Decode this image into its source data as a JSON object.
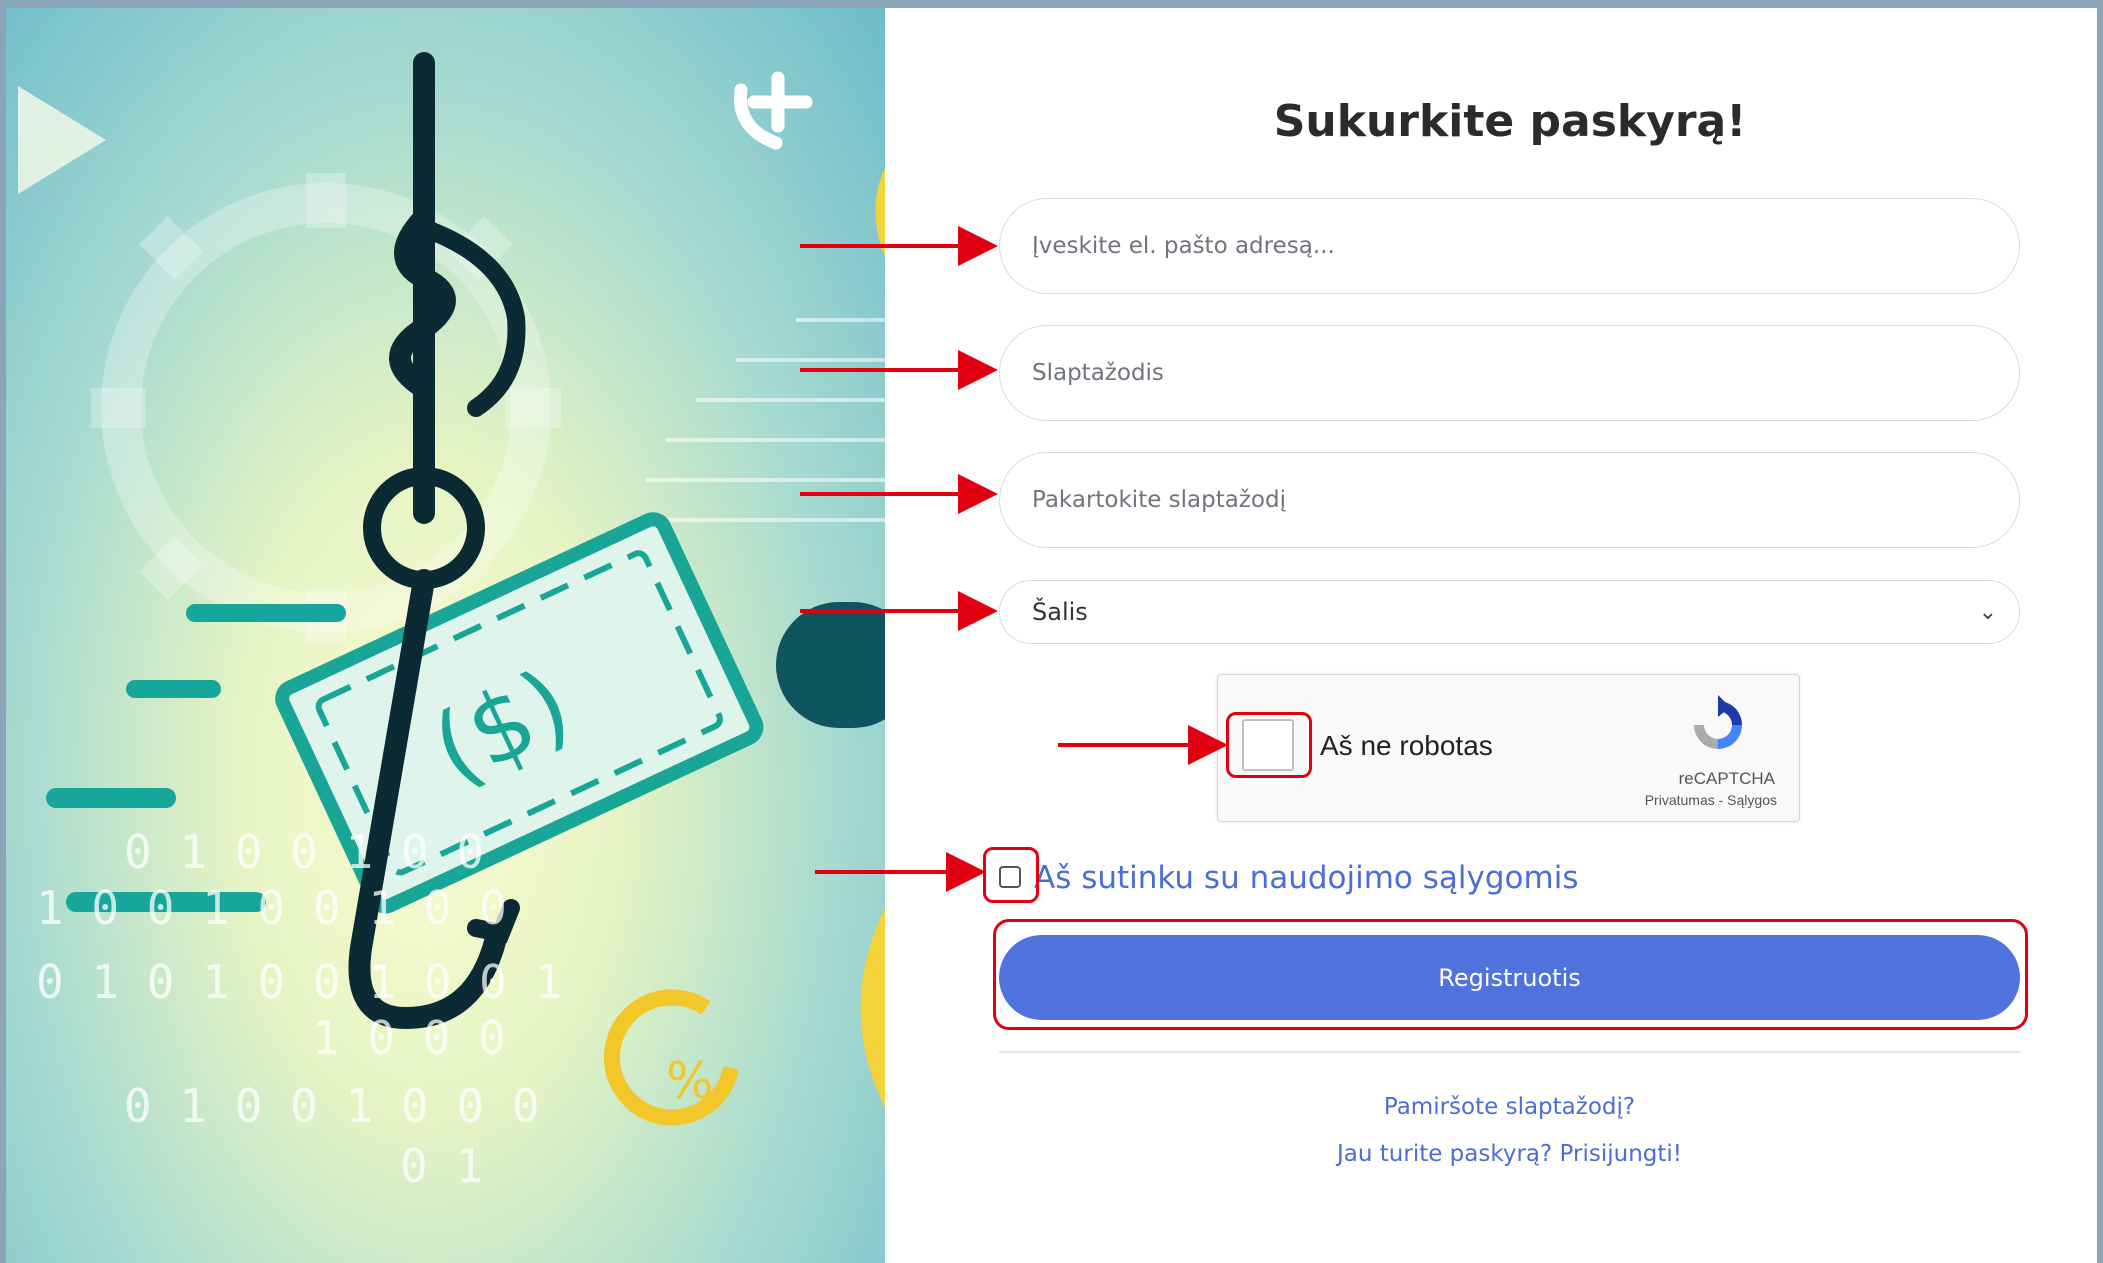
{
  "form": {
    "title": "Sukurkite paskyrą!",
    "email_placeholder": "Įveskite el. pašto adresą...",
    "password_placeholder": "Slaptažodis",
    "repeat_password_placeholder": "Pakartokite slaptažodį",
    "country_select": "Šalis",
    "terms_label": "Aš sutinku su naudojimo sąlygomis",
    "register_button": "Registruotis",
    "forgot_password_link": "Pamiršote slaptažodį?",
    "login_link": "Jau turite paskyrą? Prisijungti!"
  },
  "recaptcha": {
    "checkbox_label": "Aš ne robotas",
    "brand": "reCAPTCHA",
    "links": "Privatumas - Sąlygos"
  },
  "hero": {
    "binary_rows": [
      "0 1 0 0 1 0 0",
      "1 0 0 1 0 0 1 0 0",
      "0 1 0 1 0 0 1 0 0 1",
      "1 0 0 0",
      "0 1 0 0 1 0 0 0",
      "0 1"
    ],
    "currency_symbol": "($)"
  },
  "colors": {
    "accent": "#5072df",
    "link": "#4a6ed4",
    "annotation": "#e0000f"
  }
}
